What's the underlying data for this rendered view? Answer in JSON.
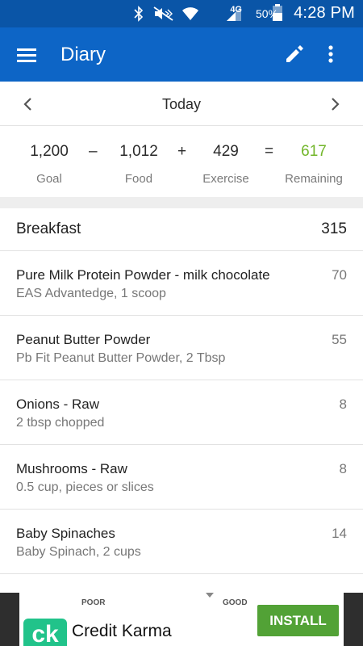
{
  "status_bar": {
    "network": "4G",
    "battery": "50%",
    "time": "4:28 PM"
  },
  "app_bar": {
    "title": "Diary"
  },
  "date_nav": {
    "label": "Today"
  },
  "summary": {
    "goal": {
      "value": "1,200",
      "label": "Goal"
    },
    "minus": "–",
    "food": {
      "value": "1,012",
      "label": "Food"
    },
    "plus": "+",
    "exercise": {
      "value": "429",
      "label": "Exercise"
    },
    "equals": "=",
    "remaining": {
      "value": "617",
      "label": "Remaining"
    }
  },
  "meal": {
    "name": "Breakfast",
    "calories": "315"
  },
  "foods": [
    {
      "name": "Pure Milk Protein Powder - milk chocolate",
      "desc": "EAS Advantedge, 1 scoop",
      "calories": "70"
    },
    {
      "name": "Peanut Butter Powder",
      "desc": "Pb Fit Peanut Butter Powder, 2 Tbsp",
      "calories": "55"
    },
    {
      "name": "Onions - Raw",
      "desc": "2 tbsp chopped",
      "calories": "8"
    },
    {
      "name": "Mushrooms - Raw",
      "desc": "0.5 cup, pieces or slices",
      "calories": "8"
    },
    {
      "name": "Baby Spinaches",
      "desc": "Baby Spinach, 2 cups",
      "calories": "14"
    }
  ],
  "ad": {
    "poor_label": "POOR",
    "good_label": "GOOD",
    "logo_text": "ck",
    "name": "Credit Karma",
    "install_label": "INSTALL"
  },
  "colors": {
    "app_bar": "#0d65c6",
    "status_bar": "#0a55a7",
    "remaining": "#72b62a",
    "install": "#52a236",
    "logo": "#21c38a"
  }
}
